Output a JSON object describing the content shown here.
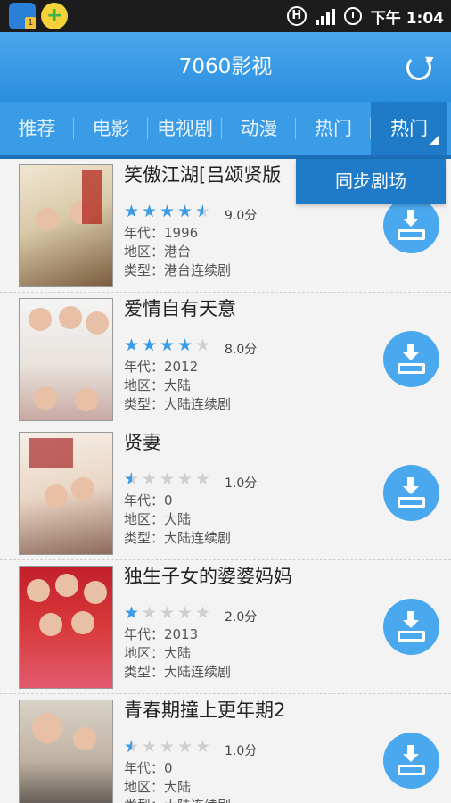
{
  "status_bar": {
    "time": "下午 1:04",
    "app1_badge": "1",
    "h_label": "H"
  },
  "header": {
    "title": "7060影视",
    "refresh_icon": "refresh-icon"
  },
  "tabs": [
    "推荐",
    "电影",
    "电视剧",
    "动漫",
    "热门",
    "热门"
  ],
  "active_tab_index": 5,
  "dropdown": {
    "item": "同步剧场"
  },
  "colors": {
    "accent": "#3a9be6",
    "active_tab": "#1f7bc7"
  },
  "items": [
    {
      "name": "笑傲江湖[吕颂贤版",
      "rating": 4.5,
      "score": "9.0分",
      "year": "年代：1996",
      "region": "地区：港台",
      "type": "类型：港台连续剧"
    },
    {
      "name": "爱情自有天意",
      "rating": 4,
      "score": "8.0分",
      "year": "年代：2012",
      "region": "地区：大陆",
      "type": "类型：大陆连续剧"
    },
    {
      "name": "贤妻",
      "rating": 0.5,
      "score": "1.0分",
      "year": "年代：0",
      "region": "地区：大陆",
      "type": "类型：大陆连续剧"
    },
    {
      "name": "独生子女的婆婆妈妈",
      "rating": 1,
      "score": "2.0分",
      "year": "年代：2013",
      "region": "地区：大陆",
      "type": "类型：大陆连续剧"
    },
    {
      "name": "青春期撞上更年期2",
      "rating": 0.5,
      "score": "1.0分",
      "year": "年代：0",
      "region": "地区：大陆",
      "type": "类型：大陆连续剧"
    }
  ]
}
